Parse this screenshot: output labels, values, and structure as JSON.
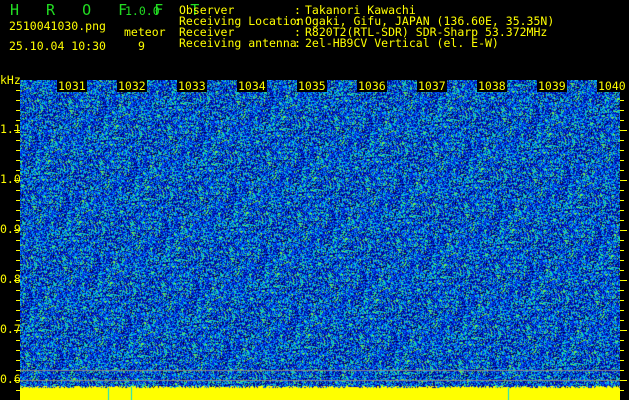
{
  "app": {
    "name": "H R O F F T",
    "version": "1.0.0"
  },
  "file": {
    "name": "2510041030.png",
    "datetime": "25.10.04 10:30"
  },
  "meteor": {
    "label": "meteor",
    "count": "9"
  },
  "info": [
    {
      "label": "Observer",
      "value": "Takanori Kawachi"
    },
    {
      "label": "Receiving Location",
      "value": "Ogaki, Gifu, JAPAN (136.60E, 35.35N)"
    },
    {
      "label": "Receiver",
      "value": "R820T2(RTL-SDR) SDR-Sharp 53.372MHz"
    },
    {
      "label": "Receiving antenna",
      "value": "2el-HB9CV Vertical (el. E-W)"
    }
  ],
  "chart_data": {
    "type": "heatmap",
    "ylabel": "kHz",
    "y_ticks": [
      "1.1",
      "1.0",
      "0.9",
      "0.8",
      "0.7",
      "0.6"
    ],
    "ylim": [
      0.58,
      1.18
    ],
    "x_ticks": [
      "1031",
      "1032",
      "1033",
      "1034",
      "1035",
      "1036",
      "1037",
      "1038",
      "1039",
      "1040"
    ],
    "xlim": [
      "1030",
      "1040"
    ]
  },
  "colors": {
    "text": "#ffff00",
    "title": "#22dd22",
    "background": "#000000",
    "noise_floor": "#ffff00"
  }
}
